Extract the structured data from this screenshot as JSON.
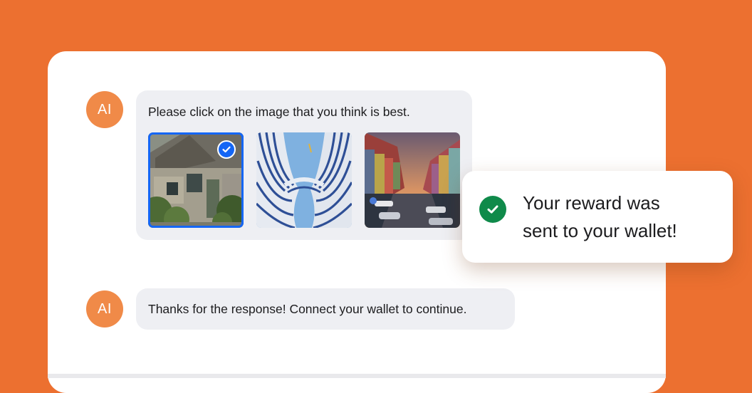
{
  "chat": {
    "messages": [
      {
        "avatar": "AI",
        "text": "Please click on the image that you think is best.",
        "images": [
          {
            "icon": "cottage-photo",
            "selected": true
          },
          {
            "icon": "building-photo",
            "selected": false
          },
          {
            "icon": "canal-photo",
            "selected": false
          }
        ]
      },
      {
        "avatar": "AI",
        "text": "Thanks for the response! Connect your wallet to continue."
      }
    ]
  },
  "toast": {
    "line1": "Your reward was",
    "line2": "sent to your wallet!",
    "icon": "check-circle-icon"
  },
  "colors": {
    "background": "#ec7030",
    "avatar": "#f08a48",
    "selection": "#1466f5",
    "success": "#0f8a4a"
  }
}
